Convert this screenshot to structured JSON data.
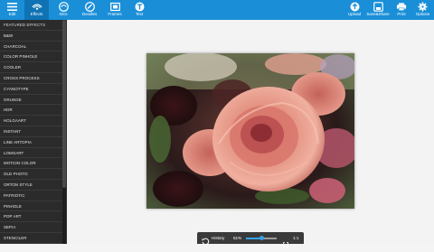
{
  "toolbar": {
    "left": [
      {
        "name": "tool-edit",
        "icon": "menu-icon",
        "label": "Edit",
        "active": false
      },
      {
        "name": "tool-effects",
        "icon": "effects-icon",
        "label": "Effects",
        "active": true
      },
      {
        "name": "tool-intro",
        "icon": "intro-icon",
        "label": "Intro",
        "active": false
      },
      {
        "name": "tool-doodles",
        "icon": "doodles-icon",
        "label": "Doodles",
        "active": false
      },
      {
        "name": "tool-frames",
        "icon": "frames-icon",
        "label": "Frames",
        "active": false
      },
      {
        "name": "tool-text",
        "icon": "text-icon",
        "label": "Text",
        "active": false
      }
    ],
    "right": [
      {
        "name": "tool-upload",
        "icon": "upload-icon",
        "label": "Upload"
      },
      {
        "name": "tool-save-share",
        "icon": "save-share-icon",
        "label": "Save&Share"
      },
      {
        "name": "tool-print",
        "icon": "print-icon",
        "label": "Print"
      },
      {
        "name": "tool-options",
        "icon": "gear-icon",
        "label": "Options"
      }
    ]
  },
  "sidebar": {
    "header": "FEATURED EFFECTS",
    "items": [
      "B&W",
      "CHARCOAL",
      "COLOR PINHOLE",
      "COOLER",
      "CROSS PROCESS",
      "CYANOTYPE",
      "GRUNGE",
      "HDR",
      "HOLGAART",
      "INSTANT",
      "LINE ARTOPIA",
      "LOMOART",
      "MOTION COLOR",
      "OLD PHOTO",
      "ORTON STYLE",
      "PATRIOTIC",
      "PINHOLE",
      "POP ART",
      "SEPIA",
      "STENCILER"
    ]
  },
  "controls": {
    "history_label": "History",
    "zoom_label": "51%",
    "zoom_value": 0.51,
    "ratio_label": "1:1"
  },
  "colors": {
    "toolbar": "#1a8fd8",
    "sidebar": "#2b2b2b",
    "accent": "#35a2e8"
  }
}
